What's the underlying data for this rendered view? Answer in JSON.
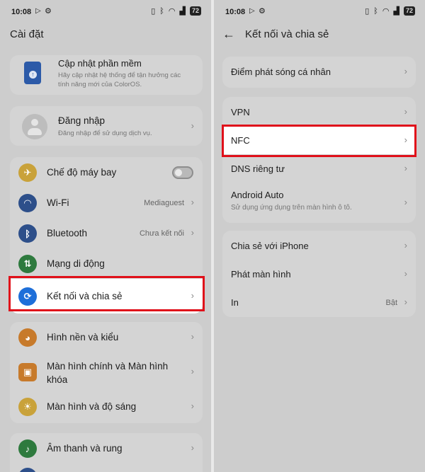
{
  "status": {
    "time": "10:08",
    "battery": "72"
  },
  "left": {
    "title": "Cài đặt",
    "update": {
      "title": "Cập nhật phần mềm",
      "desc": "Hãy cập nhật hệ thống để tận hưởng các tính năng mới của ColorOS."
    },
    "login": {
      "title": "Đăng nhập",
      "desc": "Đăng nhập để sử dụng dịch vụ."
    },
    "connectivity": [
      {
        "label": "Chế độ máy bay",
        "value": "",
        "icon": "airplane-icon",
        "color": "#c9a23a"
      },
      {
        "label": "Wi-Fi",
        "value": "Mediaguest",
        "icon": "wifi-icon",
        "color": "#2d4f8a"
      },
      {
        "label": "Bluetooth",
        "value": "Chưa kết nối",
        "icon": "bluetooth-icon",
        "color": "#2d4f8a"
      },
      {
        "label": "Mạng di động",
        "value": "",
        "icon": "mobile-data-icon",
        "color": "#2e7a3e"
      },
      {
        "label": "Kết nối và chia sẻ",
        "value": "",
        "icon": "share-icon",
        "color": "#1e6fd9"
      }
    ],
    "display": [
      {
        "label": "Hình nền và kiểu",
        "icon": "palette-icon",
        "color": "#c77a2b"
      },
      {
        "label": "Màn hình chính và Màn hình khóa",
        "icon": "homescreen-icon",
        "color": "#c77a2b"
      },
      {
        "label": "Màn hình và độ sáng",
        "icon": "brightness-icon",
        "color": "#c9a23a"
      }
    ],
    "sound": [
      {
        "label": "Âm thanh và rung",
        "icon": "bell-icon",
        "color": "#2e7a3e"
      }
    ]
  },
  "right": {
    "title": "Kết nối và chia sẻ",
    "group1": [
      {
        "label": "Điểm phát sóng cá nhân"
      }
    ],
    "group2": [
      {
        "label": "VPN"
      },
      {
        "label": "NFC"
      },
      {
        "label": "DNS riêng tư"
      },
      {
        "label": "Android Auto",
        "desc": "Sử dụng ứng dụng trên màn hình ô tô."
      }
    ],
    "group3": [
      {
        "label": "Chia sẻ với iPhone",
        "value": ""
      },
      {
        "label": "Phát màn hình",
        "value": ""
      },
      {
        "label": "In",
        "value": "Bật"
      }
    ]
  },
  "colors": {
    "highlight": "#e0101a",
    "accent": "#1e6fd9"
  }
}
